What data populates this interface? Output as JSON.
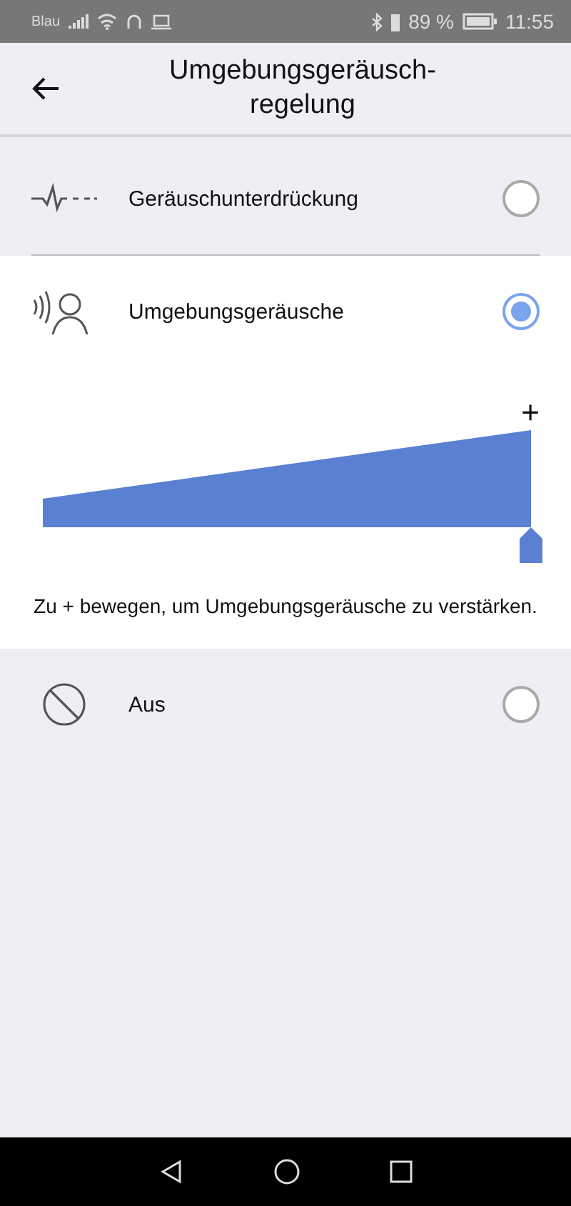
{
  "status_bar": {
    "carrier": "Blau",
    "battery": "89 %",
    "time": "11:55"
  },
  "header": {
    "title": "Umgebungsgeräusch-\nregelung"
  },
  "options": [
    {
      "kind": "noise",
      "label": "Geräuschunterdrückung",
      "selected": false
    },
    {
      "kind": "ambient",
      "label": "Umgebungsgeräusche",
      "selected": true,
      "slider": {
        "max_label": "+",
        "level": 1,
        "hint": "Zu + bewegen, um Umgebungsgeräusche zu verstärken."
      }
    },
    {
      "kind": "off",
      "label": "Aus",
      "selected": false
    }
  ]
}
